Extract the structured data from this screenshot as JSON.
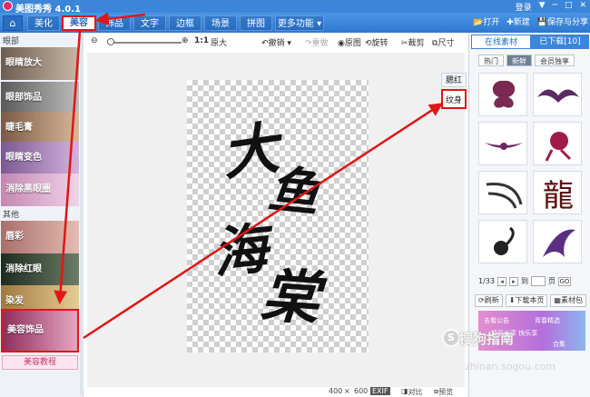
{
  "titlebar": {
    "app_title": "美图秀秀 4.0.1",
    "login": "登录",
    "controls": [
      "▼",
      "─",
      "□",
      "✕"
    ]
  },
  "nav": {
    "tabs": [
      "美化",
      "美容",
      "饰品",
      "文字",
      "边框",
      "场景",
      "拼图",
      "更多功能 ▾"
    ],
    "active_tab": "美容",
    "open_label": "打开",
    "new_label": "新建",
    "save_label": "保存与分享"
  },
  "left": {
    "section_eye": "眼部",
    "section_other": "其他",
    "items": [
      {
        "label": "眼睛放大",
        "color": "#9b8a7a"
      },
      {
        "label": "眼部饰品",
        "color": "#8d8d8d"
      },
      {
        "label": "睫毛膏",
        "color": "#b58e74"
      },
      {
        "label": "眼睛变色",
        "color": "#a480b0"
      },
      {
        "label": "消除黑眼圈",
        "color": "#d4a4c6"
      },
      {
        "label": "唇彩",
        "color": "#c48b86"
      },
      {
        "label": "消除红眼",
        "color": "#3a4b3a"
      },
      {
        "label": "染发",
        "color": "#c7a66a"
      },
      {
        "label": "美容饰品",
        "color": "#c25a86"
      }
    ],
    "selected_item": "美容饰品",
    "tutorial": "美容教程"
  },
  "toolbar": {
    "zoom_ratio": "1:1",
    "original_size": "原大",
    "undo": "撤销",
    "redo": "重做",
    "original_image": "原图",
    "rotate": "旋转",
    "crop": "裁剪",
    "size": "尺寸"
  },
  "canvas": {
    "calligraphy": [
      "大",
      "鱼",
      "海",
      "棠"
    ],
    "side_tab_1": "腮红",
    "side_tab_2": "纹身"
  },
  "status": {
    "width": "400",
    "times": "×",
    "height": "600",
    "compare": "对比",
    "preview": "预览",
    "exif": "EXIF"
  },
  "right": {
    "tabs": [
      "在线素材",
      "已下载[10]"
    ],
    "active_tab": "在线素材",
    "subtabs": [
      "热门",
      "新鲜",
      "会员独享"
    ],
    "active_subtab": "新鲜",
    "page": "1/33",
    "goto": "到",
    "page_unit": "页",
    "go": "GO",
    "refresh": "刷新",
    "download_page": "下载本页",
    "library": "素材包",
    "promo_lines": [
      "去看公告",
      "青春精选",
      "精彩分享 快乐享",
      "合集"
    ],
    "watermark": "搜狗指南",
    "watermark_url": "zhinan.sogou.com"
  },
  "colors": {
    "accent": "#3b86d8",
    "highlight": "#e01616"
  }
}
